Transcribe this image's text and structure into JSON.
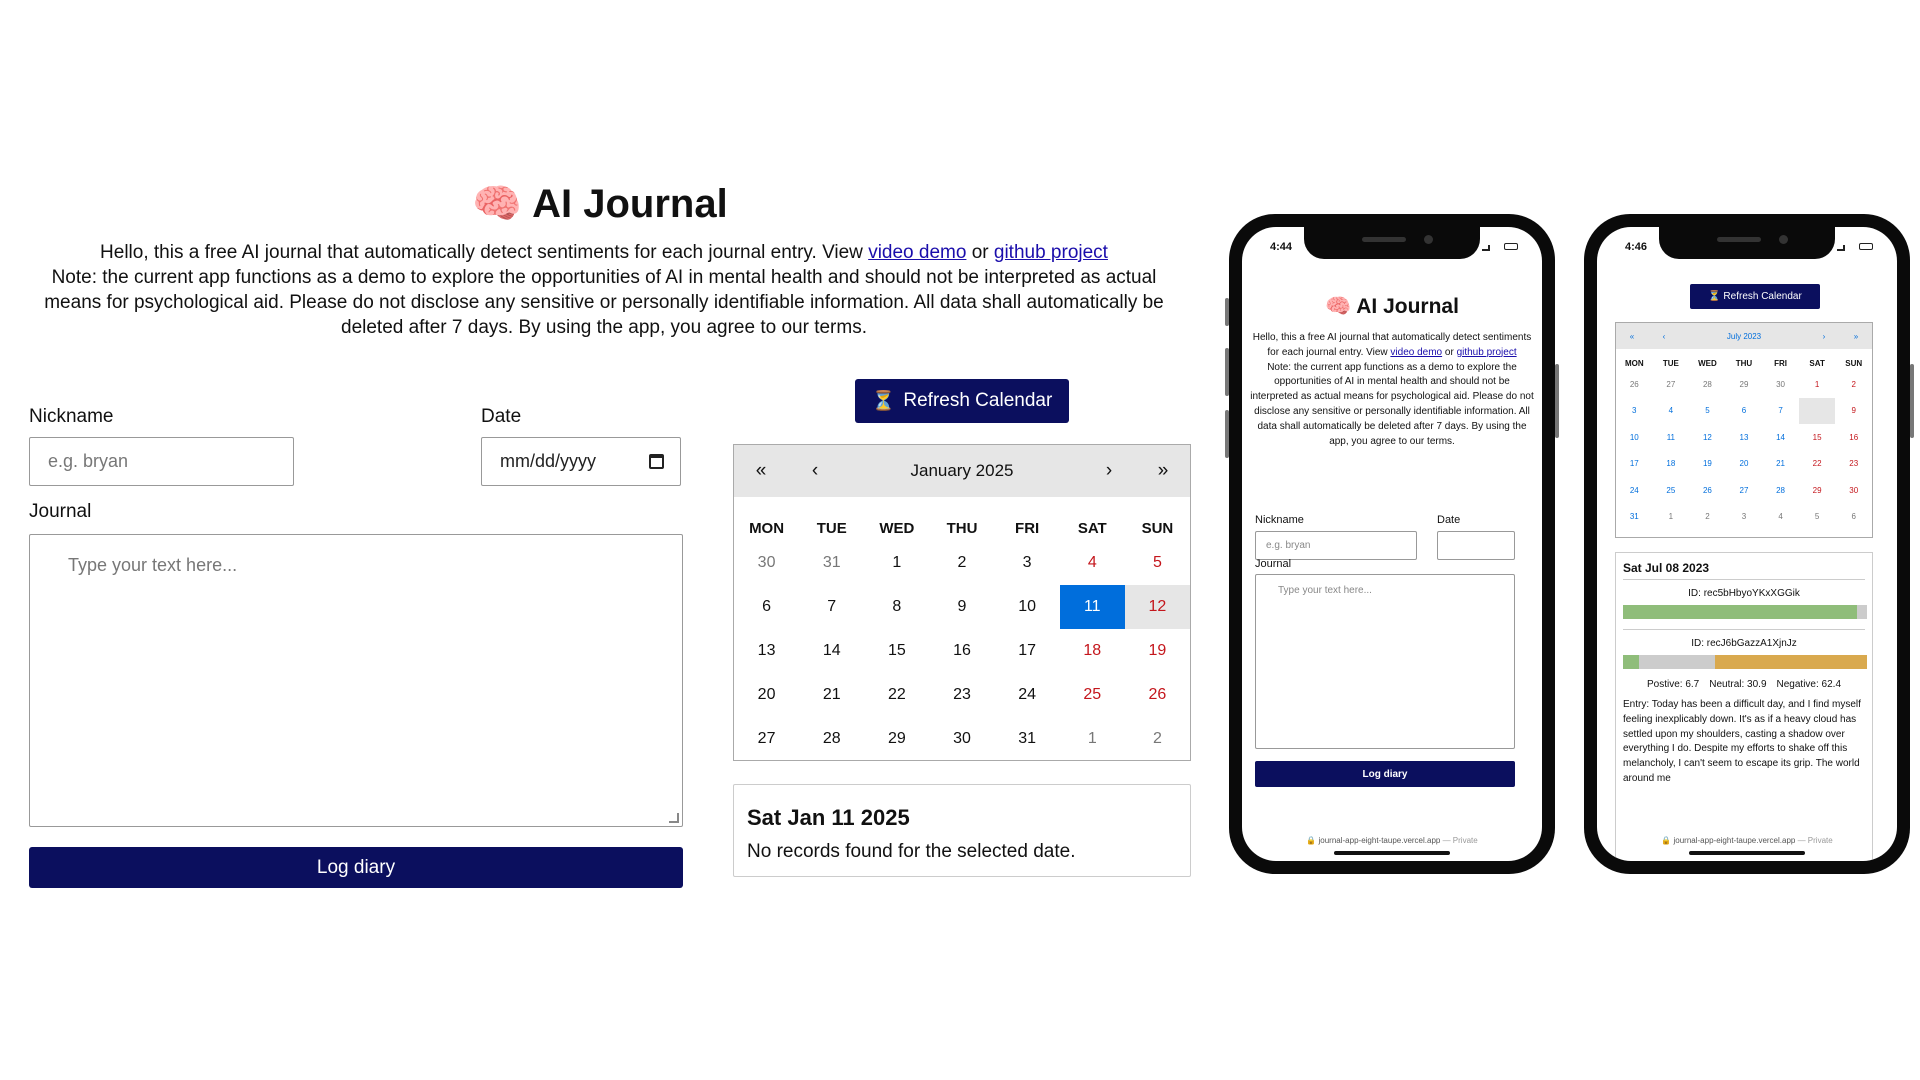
{
  "desktop": {
    "title_icon": "brain-emoji",
    "title": "AI Journal",
    "intro": {
      "line1": "Hello, this a free AI journal that automatically detect sentiments for each journal entry. View ",
      "link_video": "video demo",
      "or": " or ",
      "link_github": "github project",
      "note": "Note: the current app functions as a demo to explore the opportunities of AI in mental health and should not be interpreted as actual means for psychological aid. Please do not disclose any sensitive or personally identifiable information. All data shall automatically be deleted after 7 days. By using the app, you agree to our terms."
    },
    "form": {
      "nickname_label": "Nickname",
      "nickname_placeholder": "e.g. bryan",
      "date_label": "Date",
      "date_placeholder": "mm/dd/yyyy",
      "journal_label": "Journal",
      "journal_placeholder": "Type your text here...",
      "log_button": "Log diary"
    },
    "refresh_button": "Refresh Calendar",
    "calendar": {
      "nav": [
        "«",
        "‹",
        "›",
        "»"
      ],
      "month": "January 2025",
      "weekdays": [
        "MON",
        "TUE",
        "WED",
        "THU",
        "FRI",
        "SAT",
        "SUN"
      ],
      "days": [
        "30",
        "31",
        "1",
        "2",
        "3",
        "4",
        "5",
        "6",
        "7",
        "8",
        "9",
        "10",
        "11",
        "12",
        "13",
        "14",
        "15",
        "16",
        "17",
        "18",
        "19",
        "20",
        "21",
        "22",
        "23",
        "24",
        "25",
        "26",
        "27",
        "28",
        "29",
        "30",
        "31",
        "1",
        "2"
      ]
    },
    "records": {
      "date": "Sat Jan 11 2025",
      "message": "No records found for the selected date."
    }
  },
  "phone1": {
    "time": "4:44",
    "title": "AI Journal",
    "intro": {
      "line1": "Hello, this a free AI journal that automatically detect sentiments for each journal entry. View ",
      "link_video": "video demo",
      "or": " or ",
      "link_github": "github project",
      "note": "Note: the current app functions as a demo to explore the opportunities of AI in mental health and should not be interpreted as actual means for psychological aid. Please do not disclose any sensitive or personally identifiable information. All data shall automatically be deleted after 7 days. By using the app, you agree to our terms."
    },
    "nickname_label": "Nickname",
    "nickname_placeholder": "e.g. bryan",
    "date_label": "Date",
    "journal_label": "Journal",
    "journal_placeholder": "Type your text here...",
    "log_button": "Log diary",
    "url": "journal-app-eight-taupe.vercel.app",
    "url_suffix": " — Private"
  },
  "phone2": {
    "time": "4:46",
    "refresh_button": "Refresh Calendar",
    "calendar": {
      "nav": [
        "«",
        "‹",
        "›",
        "»"
      ],
      "month": "July 2023",
      "weekdays": [
        "MON",
        "TUE",
        "WED",
        "THU",
        "FRI",
        "SAT",
        "SUN"
      ],
      "days": [
        "26",
        "27",
        "28",
        "29",
        "30",
        "1",
        "2",
        "3",
        "4",
        "5",
        "6",
        "7",
        "8",
        "9",
        "10",
        "11",
        "12",
        "13",
        "14",
        "15",
        "16",
        "17",
        "18",
        "19",
        "20",
        "21",
        "22",
        "23",
        "24",
        "25",
        "26",
        "27",
        "28",
        "29",
        "30",
        "31",
        "1",
        "2",
        "3",
        "4",
        "5",
        "6"
      ]
    },
    "records": {
      "date": "Sat Jul 08 2023",
      "items": [
        {
          "id_label": "ID: rec5bHbyoYKxXGGik",
          "positive": 96,
          "neutral": 4,
          "negative": 0
        },
        {
          "id_label": "ID: recJ6bGazzA1XjnJz",
          "positive": 6.7,
          "neutral": 30.9,
          "negative": 62.4
        }
      ],
      "scores": {
        "positive": "Postive: 6.7",
        "neutral": "Neutral: 30.9",
        "negative": "Negative: 62.4"
      },
      "entry": "Entry: Today has been a difficult day, and I find myself feeling inexplicably down. It's as if a heavy cloud has settled upon my shoulders, casting a shadow over everything I do. Despite my efforts to shake off this melancholy, I can't seem to escape its grip. The world around me"
    },
    "url": "journal-app-eight-taupe.vercel.app",
    "url_suffix": " — Private"
  },
  "colors": {
    "primary": "#0b0f5e",
    "selected_day": "#006edc",
    "weekend": "#c4161c",
    "positive": "#8fbd7a",
    "neutral": "#cccccc",
    "negative": "#d9a94e"
  }
}
